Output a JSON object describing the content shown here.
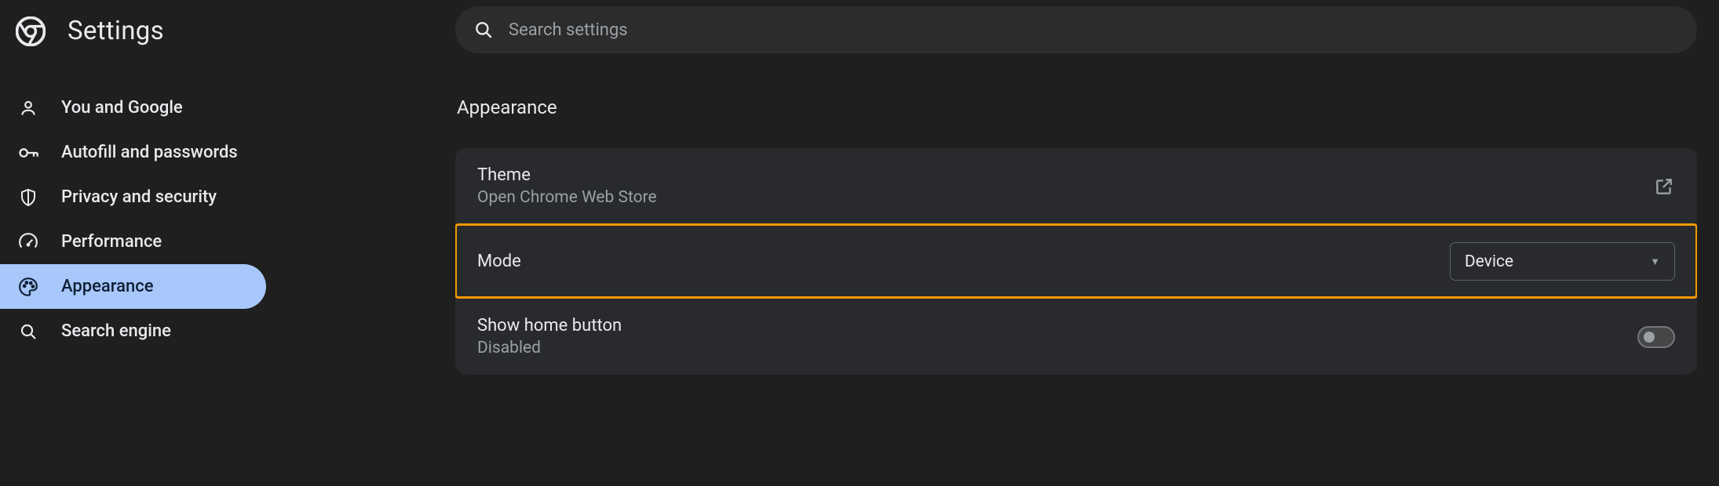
{
  "header": {
    "title": "Settings"
  },
  "search": {
    "placeholder": "Search settings"
  },
  "sidebar": {
    "items": [
      {
        "label": "You and Google"
      },
      {
        "label": "Autofill and passwords"
      },
      {
        "label": "Privacy and security"
      },
      {
        "label": "Performance"
      },
      {
        "label": "Appearance"
      },
      {
        "label": "Search engine"
      }
    ]
  },
  "main": {
    "section_title": "Appearance",
    "theme": {
      "title": "Theme",
      "subtitle": "Open Chrome Web Store"
    },
    "mode": {
      "title": "Mode",
      "selected": "Device"
    },
    "home_button": {
      "title": "Show home button",
      "subtitle": "Disabled"
    }
  }
}
